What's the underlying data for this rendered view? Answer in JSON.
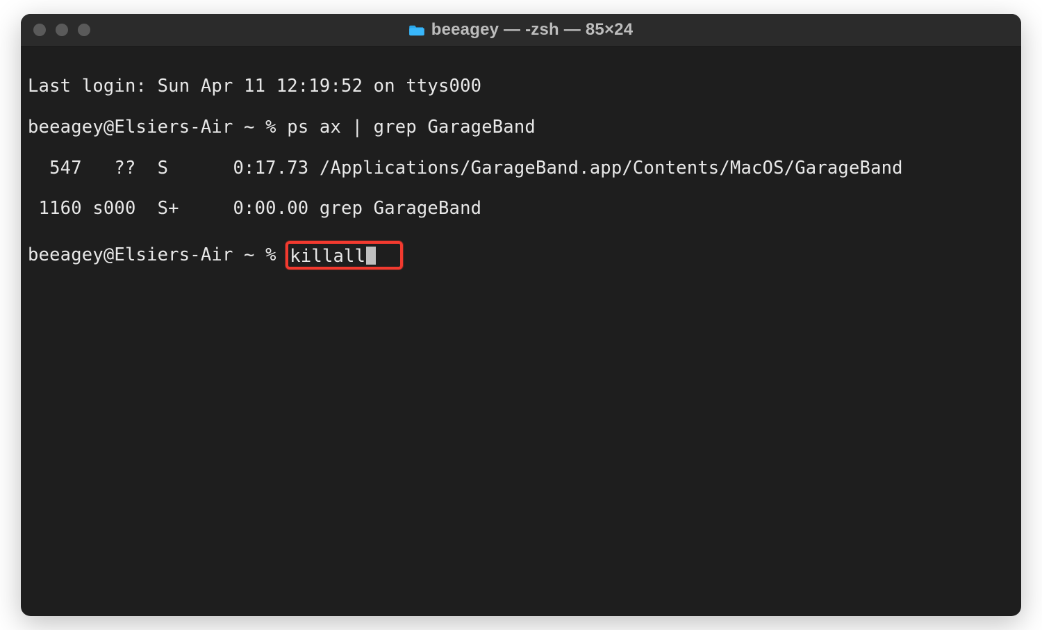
{
  "window": {
    "title": "beeagey — -zsh — 85×24"
  },
  "terminal": {
    "last_login": "Last login: Sun Apr 11 12:19:52 on ttys000",
    "prompt1_prefix": "beeagey@Elsiers-Air ~ % ",
    "prompt1_cmd": "ps ax | grep GarageBand",
    "ps_line1": "  547   ??  S      0:17.73 /Applications/GarageBand.app/Contents/MacOS/GarageBand",
    "ps_line2": " 1160 s000  S+     0:00.00 grep GarageBand",
    "prompt2_prefix": "beeagey@Elsiers-Air ~ % ",
    "prompt2_cmd": "killall"
  },
  "colors": {
    "highlight": "#f23a2f",
    "bg": "#1e1e1e",
    "titlebar": "#2b2b2b",
    "text": "#e8e8e8"
  }
}
